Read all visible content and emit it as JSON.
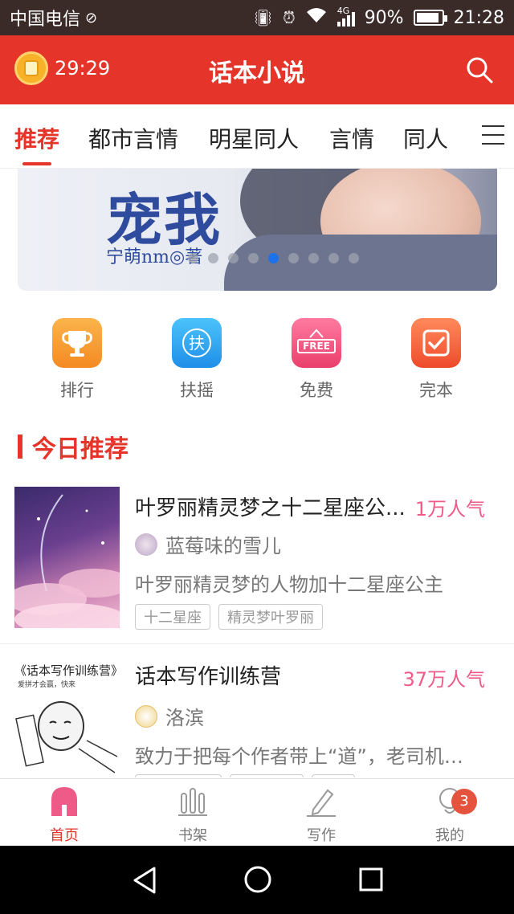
{
  "status_bar": {
    "carrier": "中国电信",
    "network": "4G",
    "battery": "90%",
    "battery_level": 0.9,
    "time": "21:28"
  },
  "header": {
    "title": "话本小说",
    "timer": "29:29"
  },
  "tabs": [
    {
      "label": "推荐",
      "active": true
    },
    {
      "label": "都市言情"
    },
    {
      "label": "明星同人"
    },
    {
      "label": "言情"
    },
    {
      "label": "同人"
    }
  ],
  "banner": {
    "big_text": "宠我",
    "author_text": "宁萌nm◎著",
    "page_count": 9,
    "current_page": 5
  },
  "quick_links": [
    {
      "label": "排行",
      "icon": "trophy-icon",
      "color": "#f79a2e"
    },
    {
      "label": "扶摇",
      "icon": "fuyao-icon",
      "glyph": "扶",
      "color": "#29a9f0"
    },
    {
      "label": "免费",
      "icon": "free-icon",
      "glyph": "FREE",
      "color": "#f2577e"
    },
    {
      "label": "完本",
      "icon": "complete-icon",
      "color": "#f2613c"
    }
  ],
  "section": {
    "title": "今日推荐"
  },
  "books": [
    {
      "title": "叶罗丽精灵梦之十二星座公...",
      "popularity": "1万人气",
      "author": "蓝莓味的雪儿",
      "description": "叶罗丽精灵梦的人物加十二星座公主",
      "tags": [
        "十二星座",
        "精灵梦叶罗丽"
      ]
    },
    {
      "title": "话本写作训练营",
      "popularity": "37万人气",
      "author": "洛滨",
      "description": "致力于把每个作者带上“道”，老司机开...",
      "cover_title": "《话本写作训练营》",
      "cover_caption": "爱拼才会赢，快来"
    }
  ],
  "bottom_nav": [
    {
      "label": "首页",
      "icon": "home-icon",
      "active": true
    },
    {
      "label": "书架",
      "icon": "bookshelf-icon"
    },
    {
      "label": "写作",
      "icon": "pen-icon"
    },
    {
      "label": "我的",
      "icon": "profile-icon",
      "badge": "3"
    }
  ],
  "colors": {
    "brand_red": "#e5352b",
    "popularity_pink": "#ee5b88"
  }
}
